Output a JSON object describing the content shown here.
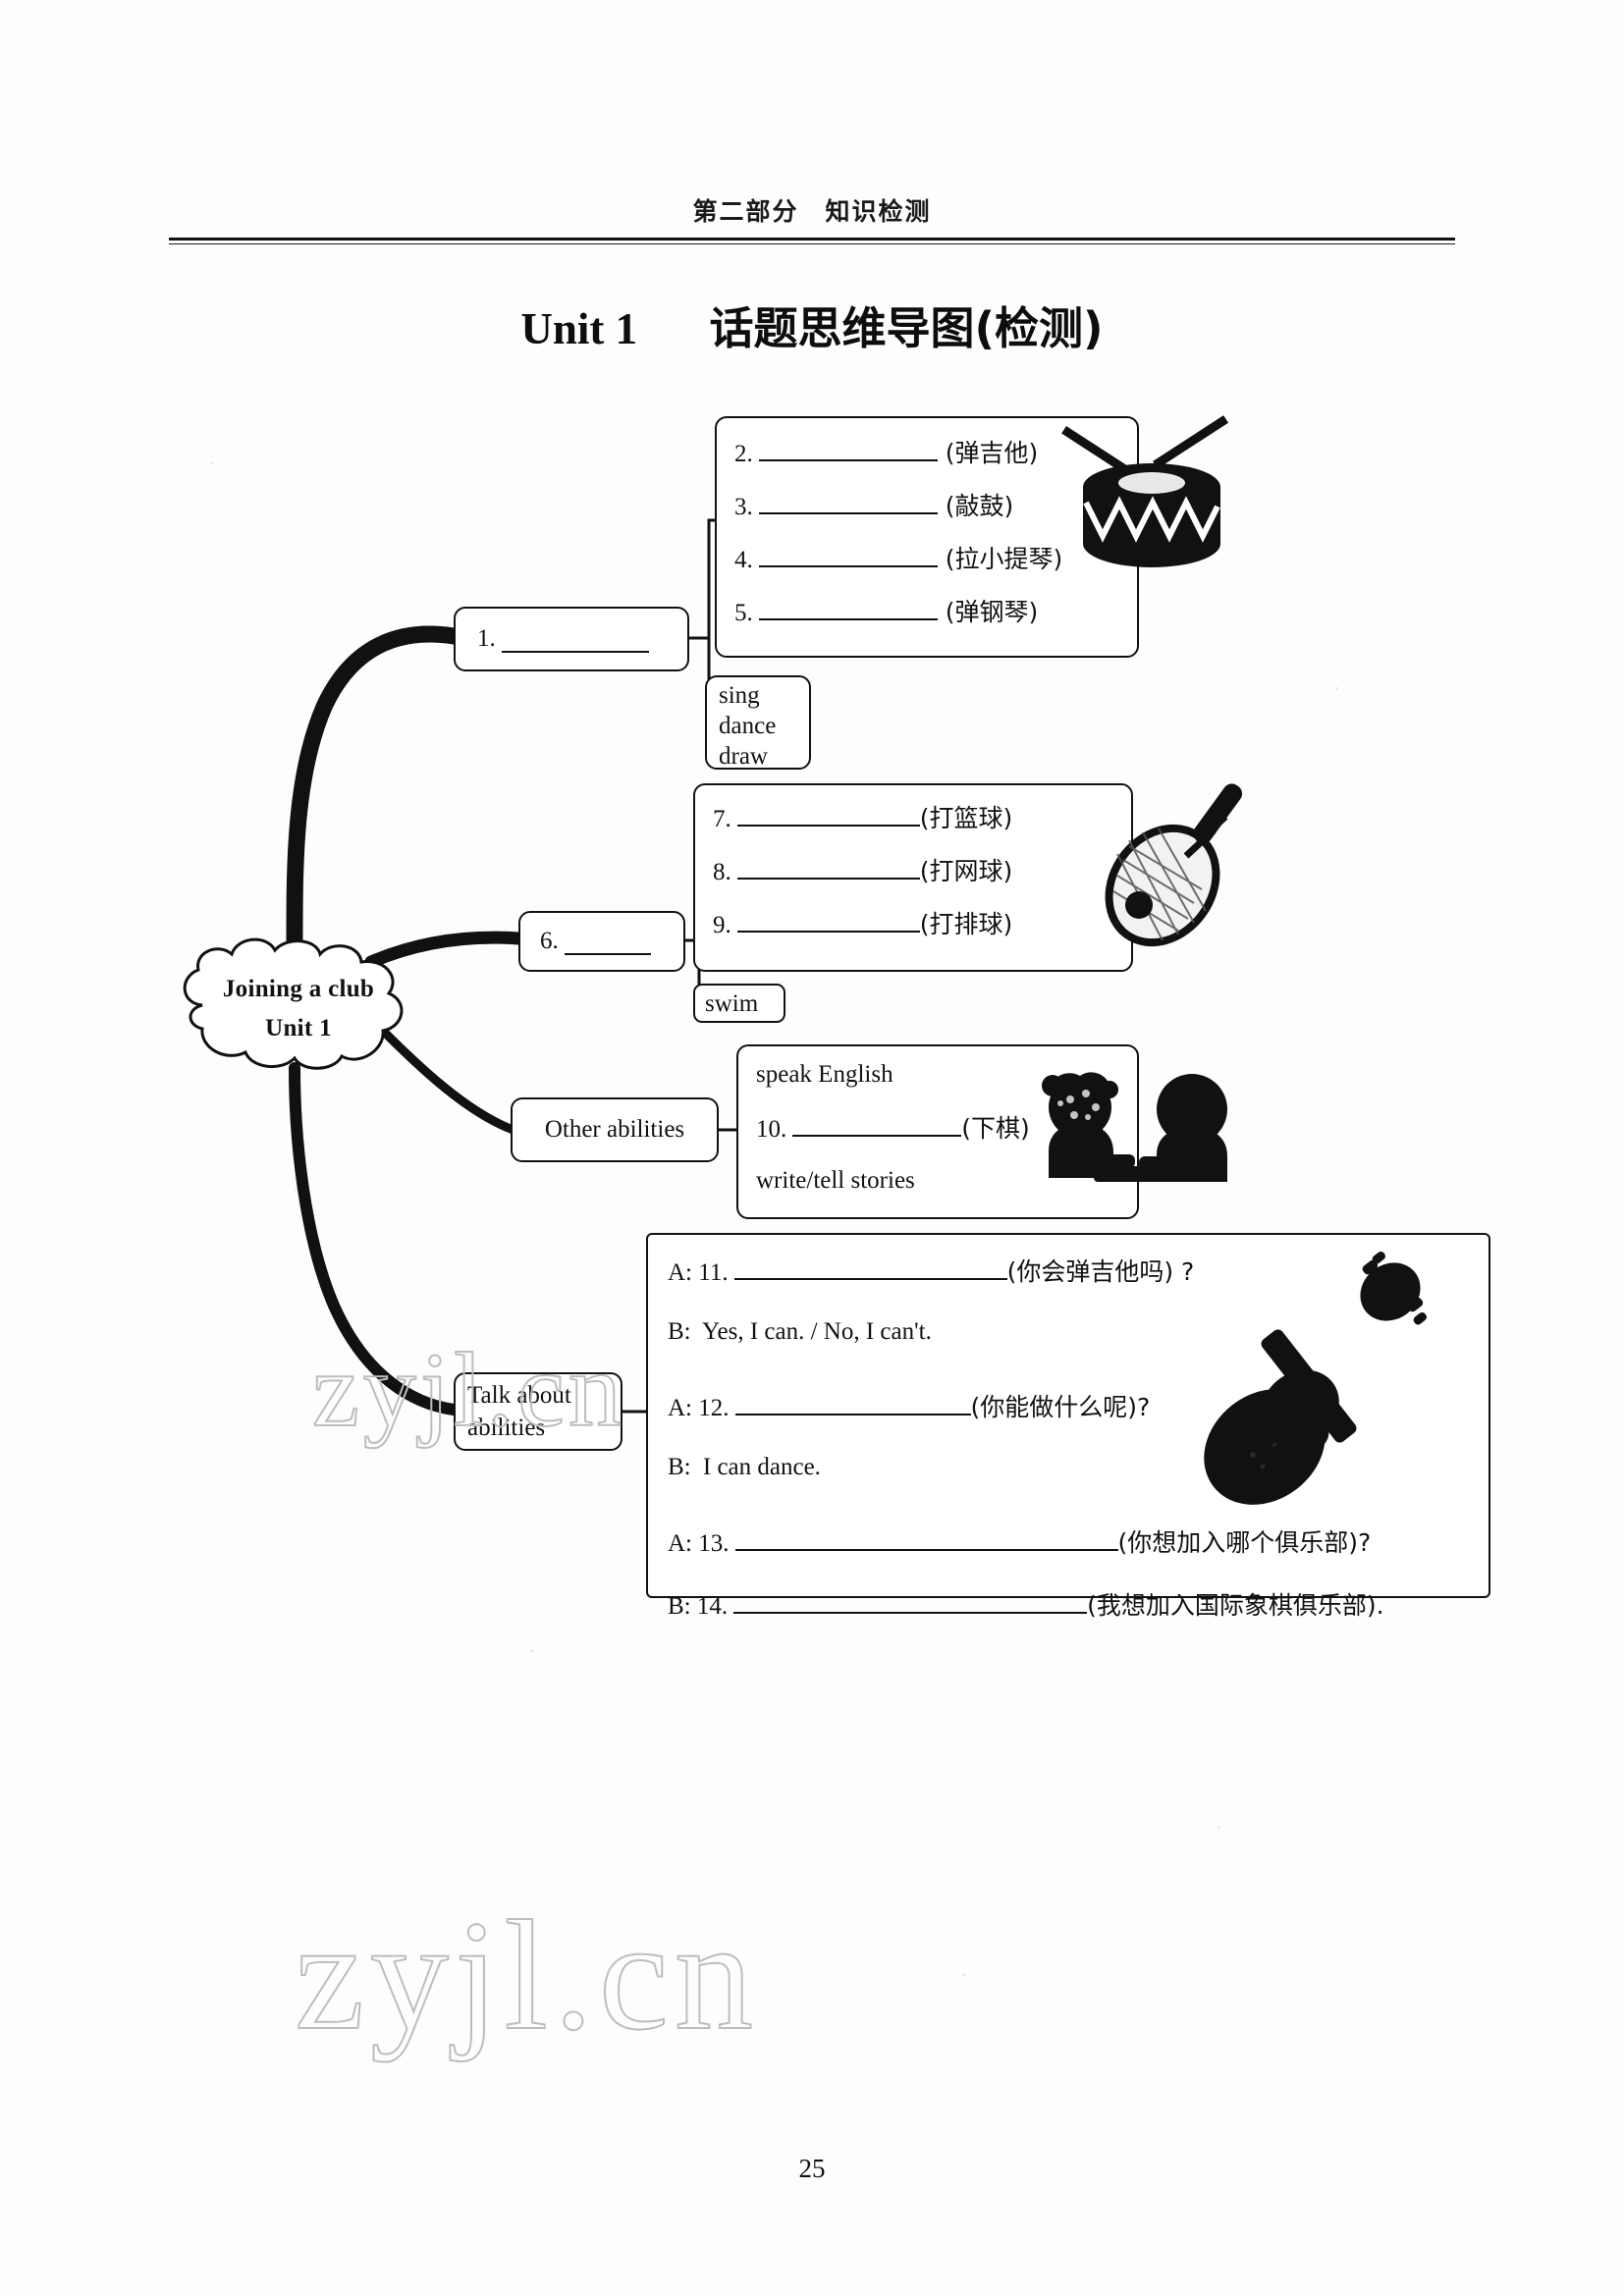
{
  "header": {
    "running_head": "第二部分　知识检测",
    "title_en": "Unit 1",
    "title_cn": "话题思维导图(检测)"
  },
  "center_node": {
    "line1": "Joining a club",
    "line2": "Unit 1"
  },
  "branches": {
    "music": {
      "node_label_num": "1.",
      "items": [
        {
          "num": "2.",
          "hint": "(弹吉他)"
        },
        {
          "num": "3.",
          "hint": "(敲鼓)"
        },
        {
          "num": "4.",
          "hint": "(拉小提琴)"
        },
        {
          "num": "5.",
          "hint": "(弹钢琴)"
        }
      ],
      "arts": [
        "sing",
        "dance",
        "draw"
      ]
    },
    "sports": {
      "node_label_num": "6.",
      "items": [
        {
          "num": "7.",
          "hint": "(打篮球)"
        },
        {
          "num": "8.",
          "hint": "(打网球)"
        },
        {
          "num": "9.",
          "hint": "(打排球)"
        }
      ],
      "extra": "swim"
    },
    "other": {
      "node_label": "Other abilities",
      "line1": "speak English",
      "item_num": "10.",
      "item_hint": "(下棋)",
      "line3": "write/tell stories"
    },
    "talk": {
      "node_label_line1": "Talk about",
      "node_label_line2": "abilities",
      "dialogue": [
        {
          "speaker": "A: 11.",
          "hint": "(你会弹吉他吗) ?",
          "blank": true
        },
        {
          "speaker": "B:",
          "text": "Yes, I can. / No, I can't.",
          "blank": false
        },
        {
          "speaker": "A: 12.",
          "hint": "(你能做什么呢)?",
          "blank": true
        },
        {
          "speaker": "B:",
          "text": "I can dance.",
          "blank": false
        },
        {
          "speaker": "A: 13.",
          "hint": "(你想加入哪个俱乐部)?",
          "blank": true
        },
        {
          "speaker": "B: 14.",
          "hint": "(我想加入国际象棋俱乐部).",
          "blank": true
        }
      ]
    }
  },
  "illustrations": {
    "drum": "drum-icon",
    "racket": "tennis-racket-icon",
    "chess": "chess-players-icon",
    "guitar": "guitar-icon"
  },
  "watermark": {
    "text_small": "zyjl.cn",
    "text_large": "zyjl.cn",
    "color": "#bdbdbd"
  },
  "footer": {
    "page_number": "25"
  }
}
